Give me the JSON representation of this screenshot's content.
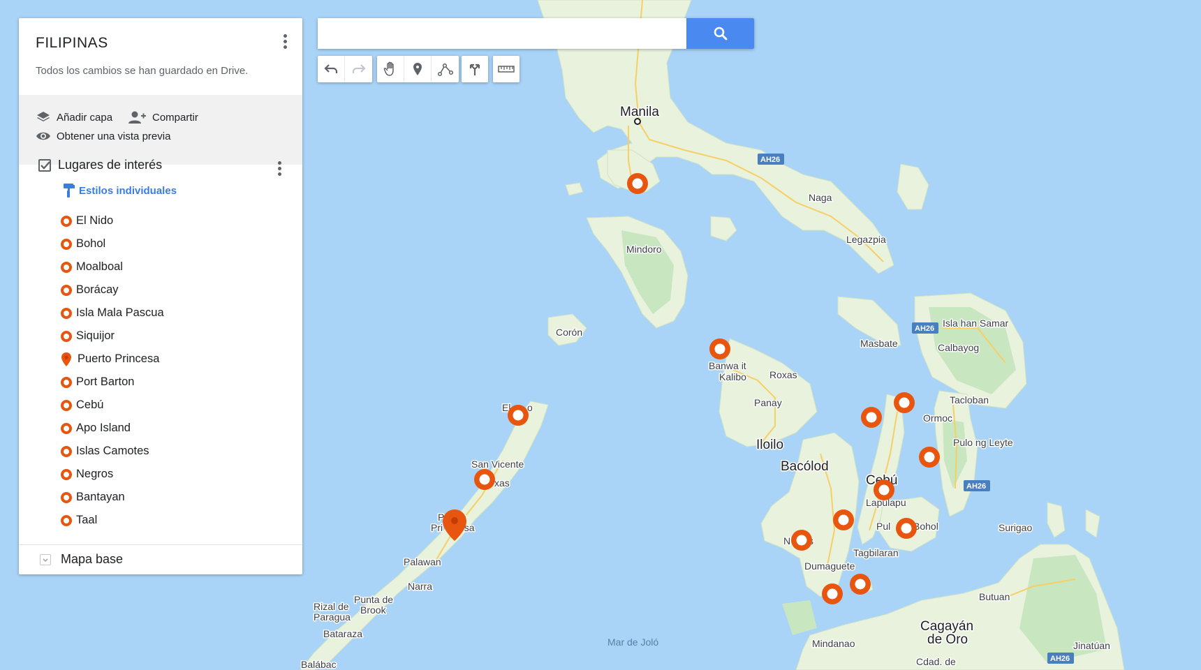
{
  "panel": {
    "title": "FILIPINAS",
    "subtitle": "Todos los cambios se han guardado en Drive.",
    "actions": {
      "add_layer": "Añadir capa",
      "share": "Compartir",
      "preview": "Obtener una vista previa"
    },
    "layer": {
      "title": "Lugares de interés",
      "checked": true,
      "styles_link": "Estilos individuales",
      "places": [
        {
          "name": "El Nido",
          "icon": "ring-icon"
        },
        {
          "name": "Bohol",
          "icon": "ring-icon"
        },
        {
          "name": "Moalboal",
          "icon": "ring-icon"
        },
        {
          "name": "Borácay",
          "icon": "ring-icon"
        },
        {
          "name": "Isla Mala Pascua",
          "icon": "ring-icon"
        },
        {
          "name": "Siquijor",
          "icon": "ring-icon"
        },
        {
          "name": "Puerto Princesa",
          "icon": "pin-icon"
        },
        {
          "name": "Port Barton",
          "icon": "ring-icon"
        },
        {
          "name": "Cebú",
          "icon": "ring-icon"
        },
        {
          "name": "Apo Island",
          "icon": "ring-icon"
        },
        {
          "name": "Islas Camotes",
          "icon": "ring-icon"
        },
        {
          "name": "Negros",
          "icon": "ring-icon"
        },
        {
          "name": "Bantayan",
          "icon": "ring-icon"
        },
        {
          "name": "Taal",
          "icon": "ring-icon"
        }
      ]
    },
    "base_map": "Mapa base"
  },
  "search": {
    "placeholder": "",
    "button_icon": "search-icon"
  },
  "toolbar": [
    "undo-icon",
    "redo-icon",
    "hand-icon",
    "marker-icon",
    "line-icon",
    "directions-icon",
    "ruler-icon"
  ],
  "map": {
    "labels": {
      "manila": "Manila",
      "naga": "Naga",
      "legazpia": "Legazpia",
      "mindoro": "Mindoro",
      "coron": "Corón",
      "banwa": "Banwa it",
      "kalibo": "Kalibo",
      "roxas": "Roxas",
      "panay": "Panay",
      "iloilo": "Iloilo",
      "bacolod": "Bacólod",
      "masbate": "Masbate",
      "samar": "Isla han Samar",
      "calbayog": "Calbayog",
      "tacloban": "Tacloban",
      "ormoc": "Ormoc",
      "leyte": "Pulo ng Leyte",
      "cebu": "Cebú",
      "lapulapu": "Lapulapu",
      "pulo": "Pul",
      "bohol": "Bohol",
      "tagbilaran": "Tagbilaran",
      "dumaguete": "Dumaguete",
      "negros_frag_n": "N",
      "negros_frag_s": "s",
      "surigao": "Surigao",
      "butuan": "Butuan",
      "cagayan1": "Cagayán",
      "cagayan2": "de Oro",
      "cdad": "Cdad. de",
      "mindanao": "Mindanao",
      "jinatuan": "Jinatúan",
      "elnido_frag1": "El",
      "elnido_frag2": "o",
      "san_vicente": "San Vicente",
      "roxas_pal": "xas",
      "pp_frag1": "P",
      "pp_frag2": "o",
      "pp_frag3": "Pri",
      "pp_frag4": "esa",
      "palawan": "Palawan",
      "narra": "Narra",
      "rizal1": "Rizal de",
      "rizal2": "Paragua",
      "punta1": "Punta de",
      "punta2": "Brook",
      "bataraza": "Bataraza",
      "balabac": "Balábac",
      "jolo": "Mar de Joló",
      "ah26": "AH26"
    },
    "marker_color": "#e8550e",
    "sea_color": "#a9d3f7",
    "land_color": "#e8f2dd",
    "forest_color": "#c8e6c0",
    "road_color": "#f8d36b"
  }
}
